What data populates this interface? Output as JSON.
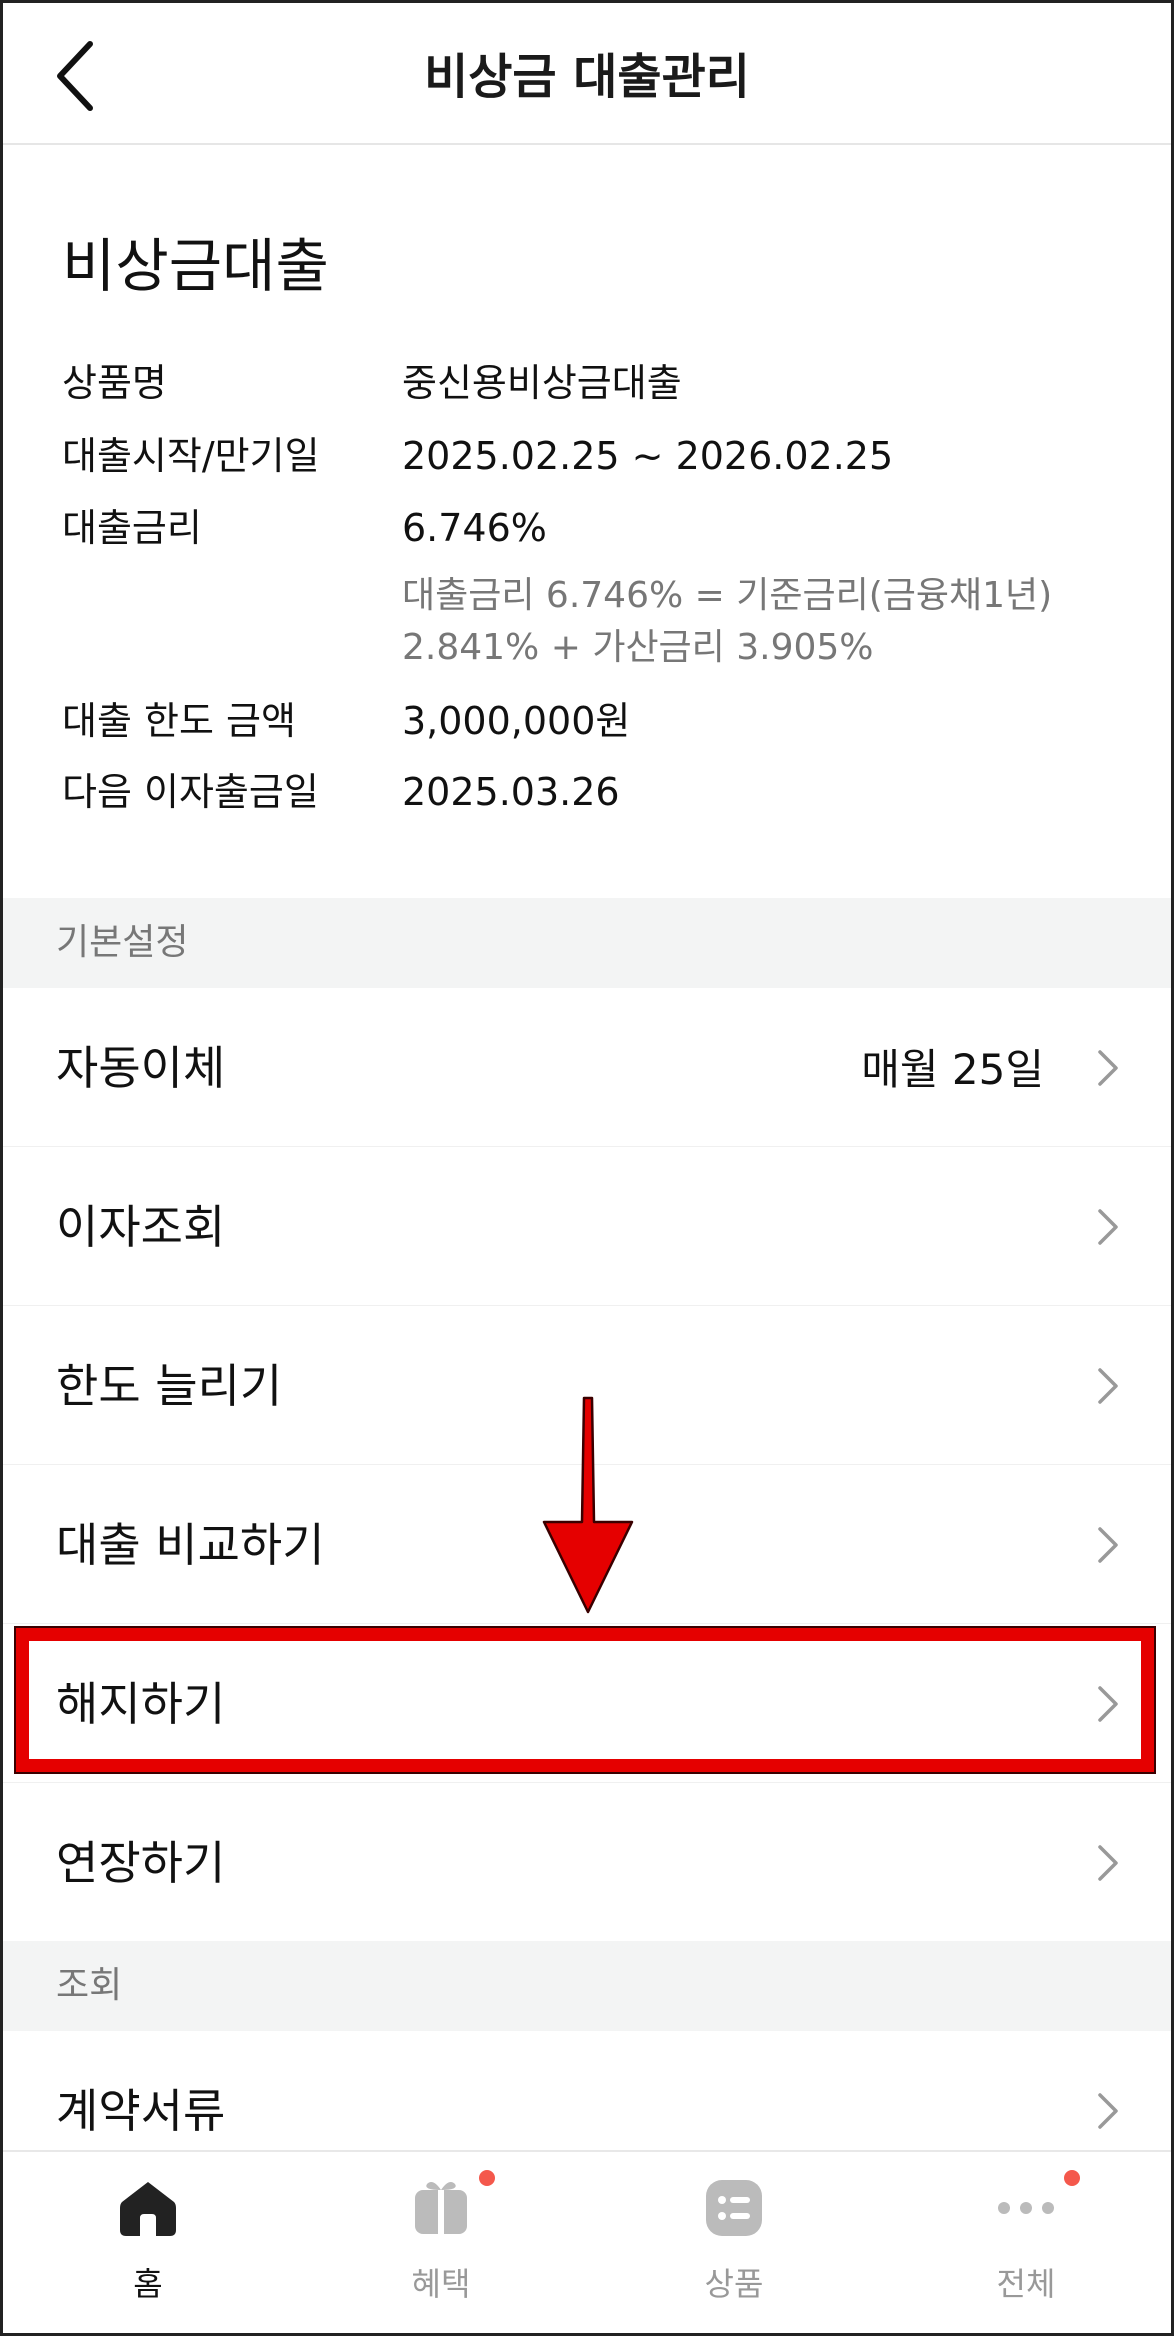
{
  "header": {
    "title": "비상금 대출관리"
  },
  "loan": {
    "section_title": "비상금대출",
    "rows": [
      {
        "label": "상품명",
        "value": "중신용비상금대출"
      },
      {
        "label": "대출시작/만기일",
        "value": "2025.02.25 ~ 2026.02.25"
      },
      {
        "label": "대출금리",
        "value": "6.746%"
      },
      {
        "label": "대출 한도 금액",
        "value": "3,000,000원"
      },
      {
        "label": "다음 이자출금일",
        "value": "2025.03.26"
      }
    ],
    "rate_note_line1": "대출금리 6.746% = 기준금리(금융채1년)",
    "rate_note_line2": "2.841% + 가산금리 3.905%"
  },
  "groups": {
    "basic": {
      "title": "기본설정",
      "items": [
        {
          "label": "자동이체",
          "value": "매월 25일"
        },
        {
          "label": "이자조회"
        },
        {
          "label": "한도 늘리기"
        },
        {
          "label": "대출 비교하기"
        },
        {
          "label": "해지하기"
        },
        {
          "label": "연장하기"
        }
      ]
    },
    "inquiry": {
      "title": "조회",
      "items": [
        {
          "label": "계약서류"
        }
      ]
    }
  },
  "tabbar": {
    "tabs": [
      {
        "label": "홈",
        "icon": "home-icon",
        "active": true
      },
      {
        "label": "혜택",
        "icon": "gift-icon",
        "badge": true
      },
      {
        "label": "상품",
        "icon": "list-icon"
      },
      {
        "label": "전체",
        "icon": "more-icon",
        "badge": true
      }
    ]
  },
  "colors": {
    "highlight": "#e50000",
    "badge": "#f4584c",
    "muted_text": "#777777",
    "section_bg": "#f3f4f4"
  }
}
